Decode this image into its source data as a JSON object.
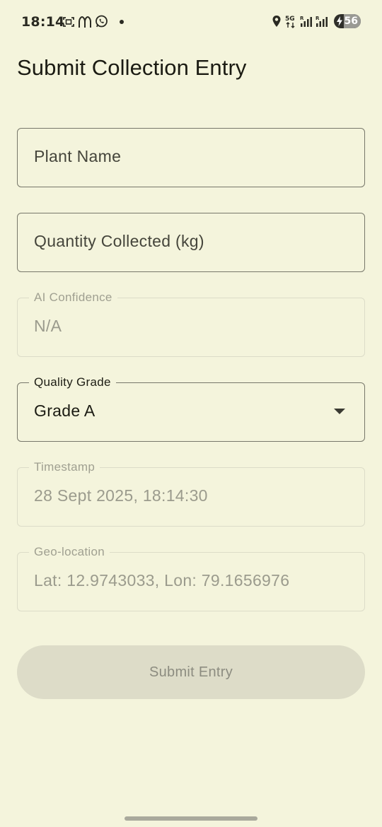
{
  "status_bar": {
    "time": "18:14",
    "battery_level": "56",
    "left_icons": [
      "screenshot-icon",
      "mcdonalds-icon",
      "whatsapp-icon",
      "notification-dot-icon"
    ],
    "right_icons": [
      "location-icon",
      "5g-data-icon",
      "signal-icon",
      "signal-icon",
      "battery-icon"
    ]
  },
  "page": {
    "title": "Submit Collection Entry"
  },
  "form": {
    "plant_name": {
      "placeholder": "Plant Name"
    },
    "quantity": {
      "placeholder": "Quantity Collected (kg)"
    },
    "ai_confidence": {
      "label": "AI Confidence",
      "value": "N/A"
    },
    "quality_grade": {
      "label": "Quality Grade",
      "value": "Grade A"
    },
    "timestamp": {
      "label": "Timestamp",
      "value": "28 Sept 2025, 18:14:30"
    },
    "geo_location": {
      "label": "Geo-location",
      "value": "Lat: 12.9743033, Lon: 79.1656976"
    }
  },
  "submit_button": {
    "label": "Submit Entry"
  },
  "colors": {
    "background": "#f4f4dc",
    "outline": "#77776a",
    "disabled_outline": "#dcdcc8",
    "button_disabled": "#dddcc8"
  }
}
